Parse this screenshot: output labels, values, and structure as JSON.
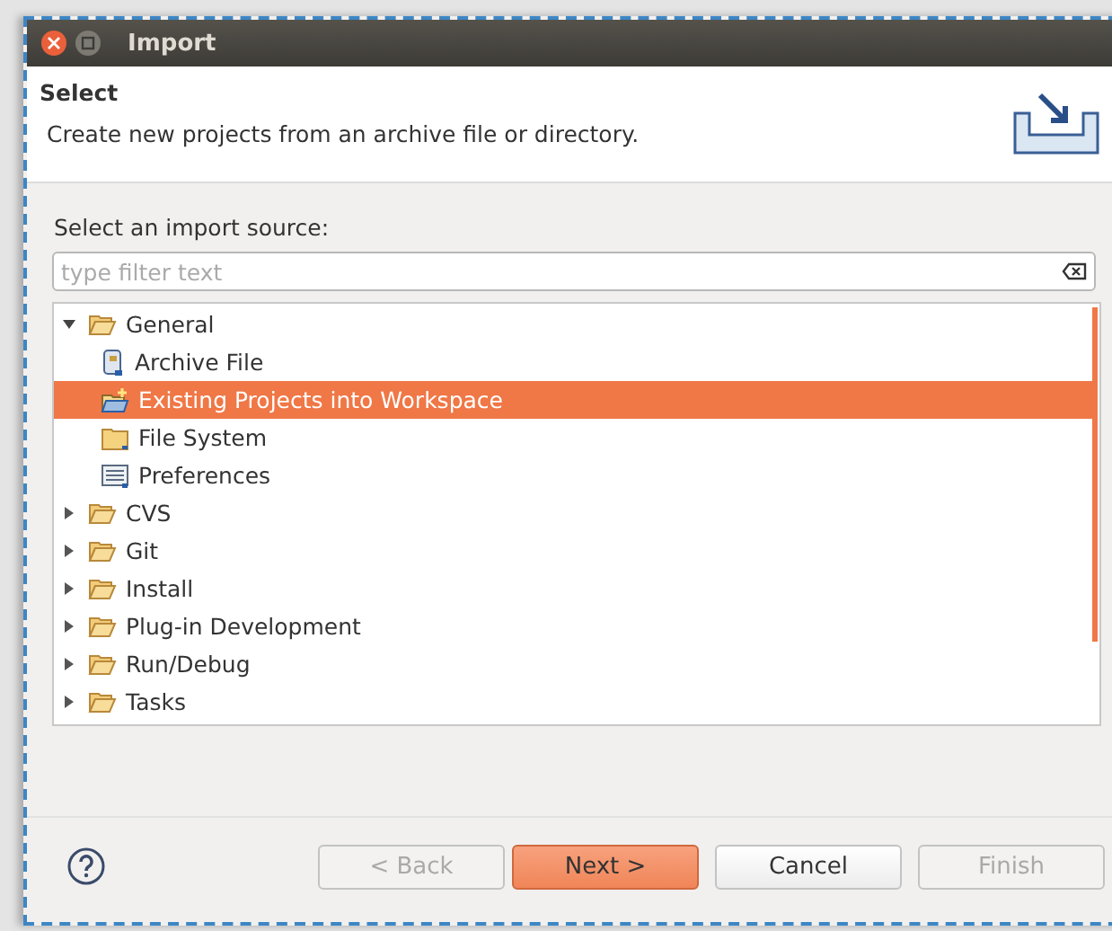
{
  "window": {
    "title": "Import"
  },
  "header": {
    "title": "Select",
    "description": "Create new projects from an archive file or directory."
  },
  "source_label": "Select an import source:",
  "filter": {
    "placeholder": "type filter text"
  },
  "tree": [
    {
      "label": "General",
      "kind": "folder",
      "expanded": true,
      "selected": false,
      "children": [
        {
          "label": "Archive File",
          "kind": "archive",
          "selected": false
        },
        {
          "label": "Existing Projects into Workspace",
          "kind": "project",
          "selected": true
        },
        {
          "label": "File System",
          "kind": "folder-closed",
          "selected": false
        },
        {
          "label": "Preferences",
          "kind": "preferences",
          "selected": false
        }
      ]
    },
    {
      "label": "CVS",
      "kind": "folder",
      "expanded": false,
      "selected": false
    },
    {
      "label": "Git",
      "kind": "folder",
      "expanded": false,
      "selected": false
    },
    {
      "label": "Install",
      "kind": "folder",
      "expanded": false,
      "selected": false
    },
    {
      "label": "Plug-in Development",
      "kind": "folder",
      "expanded": false,
      "selected": false
    },
    {
      "label": "Run/Debug",
      "kind": "folder",
      "expanded": false,
      "selected": false
    },
    {
      "label": "Tasks",
      "kind": "folder",
      "expanded": false,
      "selected": false
    }
  ],
  "buttons": [
    {
      "label": "< Back",
      "disabled": true,
      "default": false
    },
    {
      "label": "Next >",
      "disabled": false,
      "default": true
    },
    {
      "label": "Cancel",
      "disabled": false,
      "default": false
    },
    {
      "label": "Finish",
      "disabled": true,
      "default": false
    }
  ]
}
